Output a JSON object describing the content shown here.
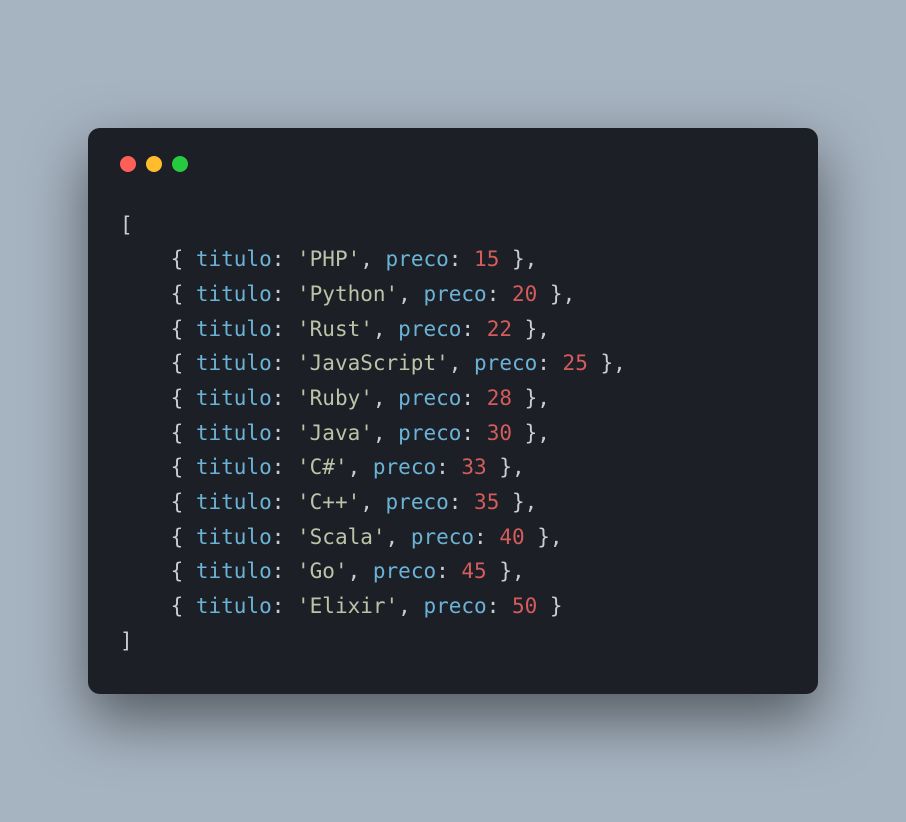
{
  "code": {
    "open_bracket": "[",
    "close_bracket": "]",
    "open_brace": "{ ",
    "close_brace": " }",
    "close_brace_comma": " },",
    "colon": ": ",
    "comma_space": ", ",
    "key_titulo": "titulo",
    "key_preco": "preco",
    "items": [
      {
        "titulo": "'PHP'",
        "preco": "15",
        "last": false
      },
      {
        "titulo": "'Python'",
        "preco": "20",
        "last": false
      },
      {
        "titulo": "'Rust'",
        "preco": "22",
        "last": false
      },
      {
        "titulo": "'JavaScript'",
        "preco": "25",
        "last": false
      },
      {
        "titulo": "'Ruby'",
        "preco": "28",
        "last": false
      },
      {
        "titulo": "'Java'",
        "preco": "30",
        "last": false
      },
      {
        "titulo": "'C#'",
        "preco": "33",
        "last": false
      },
      {
        "titulo": "'C++'",
        "preco": "35",
        "last": false
      },
      {
        "titulo": "'Scala'",
        "preco": "40",
        "last": false
      },
      {
        "titulo": "'Go'",
        "preco": "45",
        "last": false
      },
      {
        "titulo": "'Elixir'",
        "preco": "50",
        "last": true
      }
    ]
  }
}
